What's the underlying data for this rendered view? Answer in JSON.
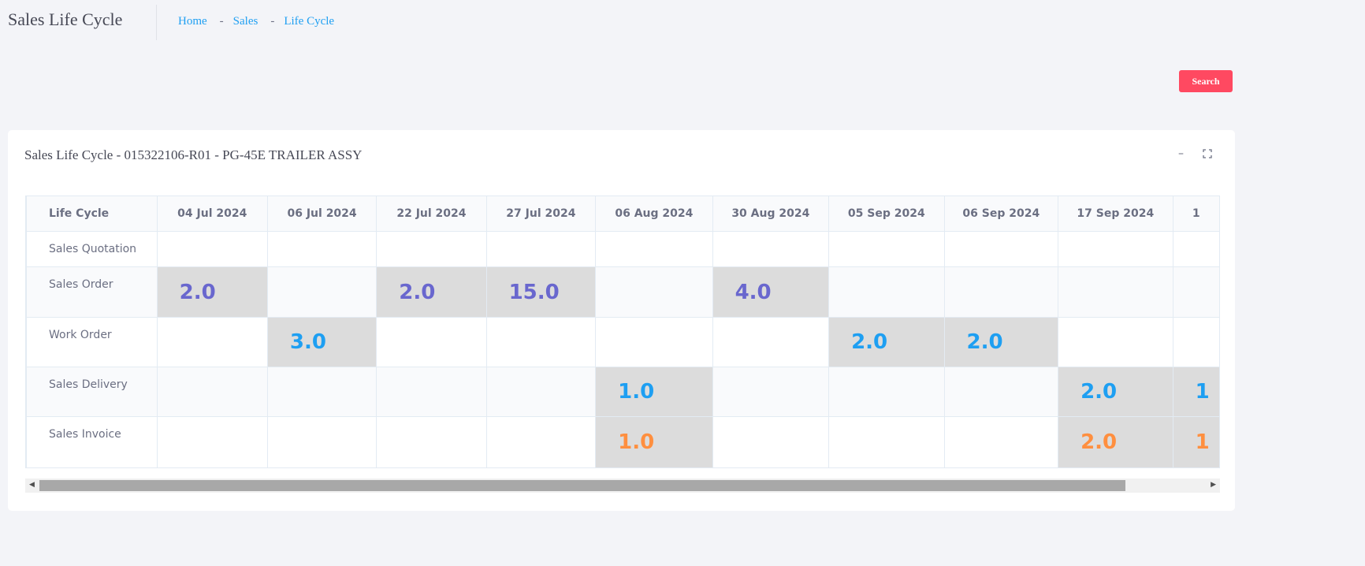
{
  "header": {
    "title": "Sales Life Cycle",
    "breadcrumbs": [
      "Home",
      "Sales",
      "Life Cycle"
    ],
    "search_label": "Search"
  },
  "card": {
    "title": "Sales Life Cycle - 015322106-R01 - PG-45E TRAILER ASSY",
    "minimize_icon": "minus-icon",
    "expand_icon": "expand-icon"
  },
  "table": {
    "label_header": "Life Cycle",
    "columns": [
      "04 Jul 2024",
      "06 Jul 2024",
      "22 Jul 2024",
      "27 Jul 2024",
      "06 Aug 2024",
      "30 Aug 2024",
      "05 Sep 2024",
      "06 Sep 2024",
      "17 Sep 2024",
      "1"
    ],
    "rows": [
      {
        "label": "Sales Quotation",
        "color": "#6967ce",
        "cells": [
          "",
          "",
          "",
          "",
          "",
          "",
          "",
          "",
          "",
          ""
        ]
      },
      {
        "label": "Sales Order",
        "color": "#6967ce",
        "cells": [
          "2.0",
          "",
          "2.0",
          "15.0",
          "",
          "4.0",
          "",
          "",
          "",
          ""
        ]
      },
      {
        "label": "Work Order",
        "color": "#1e9ff2",
        "cells": [
          "",
          "3.0",
          "",
          "",
          "",
          "",
          "2.0",
          "2.0",
          "",
          ""
        ]
      },
      {
        "label": "Sales Delivery",
        "color": "#1e9ff2",
        "cells": [
          "",
          "",
          "",
          "",
          "1.0",
          "",
          "",
          "",
          "2.0",
          "1"
        ]
      },
      {
        "label": "Sales Invoice",
        "color": "#ff8f3f",
        "cells": [
          "",
          "",
          "",
          "",
          "1.0",
          "",
          "",
          "",
          "2.0",
          "1"
        ]
      }
    ]
  },
  "colors": {
    "highlight": "#dcdcdc",
    "search_button": "#ff4961",
    "link": "#1e9ff2"
  }
}
